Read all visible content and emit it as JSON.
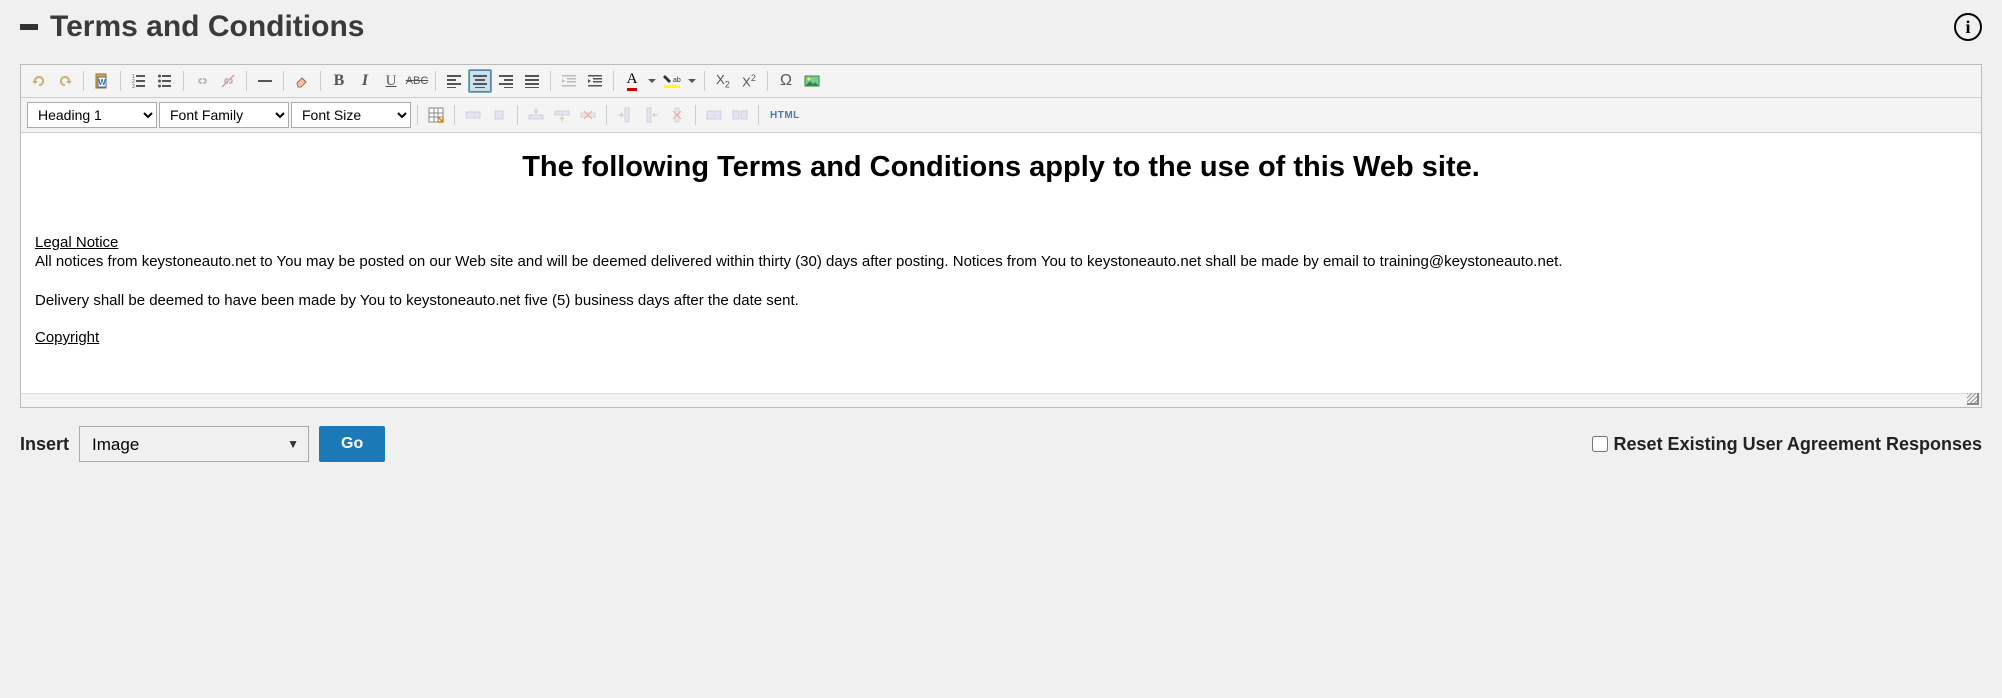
{
  "header": {
    "title": "Terms and Conditions"
  },
  "toolbar": {
    "format_select": "Heading 1",
    "font_family": "Font Family",
    "font_size": "Font Size",
    "html_label": "HTML"
  },
  "content": {
    "heading": "The following Terms and Conditions apply to the use of this Web site.",
    "legal_notice_label": "Legal Notice",
    "para1": "All notices from keystoneauto.net to You may be posted on our Web site and will be deemed delivered within thirty (30) days after posting. Notices from You to keystoneauto.net shall be made by email to training@keystoneauto.net.",
    "para2": "Delivery shall be deemed to have been made by You to keystoneauto.net five (5) business days after the date sent.",
    "copyright_label": "Copyright"
  },
  "footer": {
    "insert_label": "Insert",
    "insert_options": [
      "Image"
    ],
    "insert_selected": "Image",
    "go_label": "Go",
    "reset_label": "Reset Existing User Agreement Responses"
  }
}
